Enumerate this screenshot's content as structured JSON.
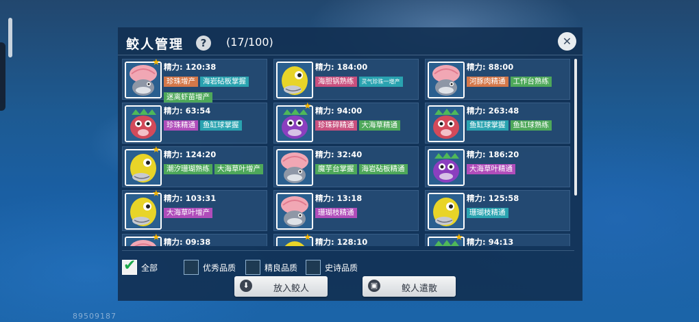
{
  "header": {
    "title": "鲛人管理",
    "count": "(17/100)"
  },
  "fish": [
    {
      "kind": "pink-shell",
      "star": true,
      "energy": "精力: 120:38",
      "tags": [
        {
          "t": "珍珠增产",
          "c": "orange"
        },
        {
          "t": "海岩砧板掌握",
          "c": "teal"
        },
        {
          "t": "迷离虾苗增产",
          "c": "green"
        }
      ]
    },
    {
      "kind": "yellow",
      "star": false,
      "energy": "精力: 184:00",
      "tags": [
        {
          "t": "海胆锅熟练",
          "c": "pink"
        },
        {
          "t": "灵气珍珠一增产",
          "c": "teal",
          "small": true
        }
      ]
    },
    {
      "kind": "pink-shell",
      "star": false,
      "energy": "精力: 88:00",
      "tags": [
        {
          "t": "河豚肉精通",
          "c": "orange"
        },
        {
          "t": "工作台熟练",
          "c": "green"
        }
      ]
    },
    {
      "kind": "red-crown",
      "star": false,
      "energy": "精力: 63:54",
      "tags": [
        {
          "t": "珍珠精通",
          "c": "purple"
        },
        {
          "t": "鱼缸球掌握",
          "c": "teal"
        }
      ]
    },
    {
      "kind": "purple-crown",
      "star": true,
      "energy": "精力: 94:00",
      "tags": [
        {
          "t": "珍珠碎精通",
          "c": "pink"
        },
        {
          "t": "大海草精通",
          "c": "green"
        }
      ]
    },
    {
      "kind": "red-crown",
      "star": false,
      "energy": "精力: 263:48",
      "tags": [
        {
          "t": "鱼缸球掌握",
          "c": "teal"
        },
        {
          "t": "鱼缸球熟练",
          "c": "green"
        }
      ]
    },
    {
      "kind": "yellow",
      "star": true,
      "energy": "精力: 124:20",
      "tags": [
        {
          "t": "潮汐珊瑚熟练",
          "c": "green"
        },
        {
          "t": "大海草叶增产",
          "c": "green"
        }
      ]
    },
    {
      "kind": "pink-shell",
      "star": false,
      "energy": "精力: 32:40",
      "tags": [
        {
          "t": "魔芋台掌握",
          "c": "green"
        },
        {
          "t": "海岩砧板精通",
          "c": "green"
        }
      ]
    },
    {
      "kind": "purple-crown",
      "star": false,
      "energy": "精力: 186:20",
      "tags": [
        {
          "t": "大海草叶精通",
          "c": "purple"
        }
      ]
    },
    {
      "kind": "yellow",
      "star": true,
      "energy": "精力: 103:31",
      "tags": [
        {
          "t": "大海草叶增产",
          "c": "purple"
        }
      ]
    },
    {
      "kind": "pink-shell",
      "star": false,
      "energy": "精力: 13:18",
      "tags": [
        {
          "t": "珊瑚枝精通",
          "c": "purple"
        }
      ]
    },
    {
      "kind": "yellow",
      "star": false,
      "energy": "精力: 125:58",
      "tags": [
        {
          "t": "珊瑚枝精通",
          "c": "teal"
        }
      ]
    },
    {
      "kind": "pink-shell",
      "star": true,
      "energy": "精力: 09:38",
      "tags": []
    },
    {
      "kind": "yellow",
      "star": true,
      "energy": "精力: 128:10",
      "tags": []
    },
    {
      "kind": "purple-crown",
      "star": true,
      "energy": "精力: 94:13",
      "tags": []
    }
  ],
  "filters": [
    {
      "label": "全部",
      "checked": true
    },
    {
      "label": "优秀品质",
      "checked": false
    },
    {
      "label": "精良品质",
      "checked": false
    },
    {
      "label": "史诗品质",
      "checked": false
    }
  ],
  "buttons": {
    "put_in": "放入鲛人",
    "dismiss": "鲛人遣散"
  },
  "footer_id": "89509187",
  "icons": {
    "help": "question-icon",
    "close": "close-icon",
    "star": "star-icon",
    "put_in": "download-icon",
    "dismiss": "box-icon"
  },
  "colors": {
    "tag_orange": "#d4784a",
    "tag_teal": "#2aa3b0",
    "tag_green": "#4ea85a",
    "tag_purple": "#b04dba",
    "tag_pink": "#c9507e",
    "star": "#f4b400"
  }
}
